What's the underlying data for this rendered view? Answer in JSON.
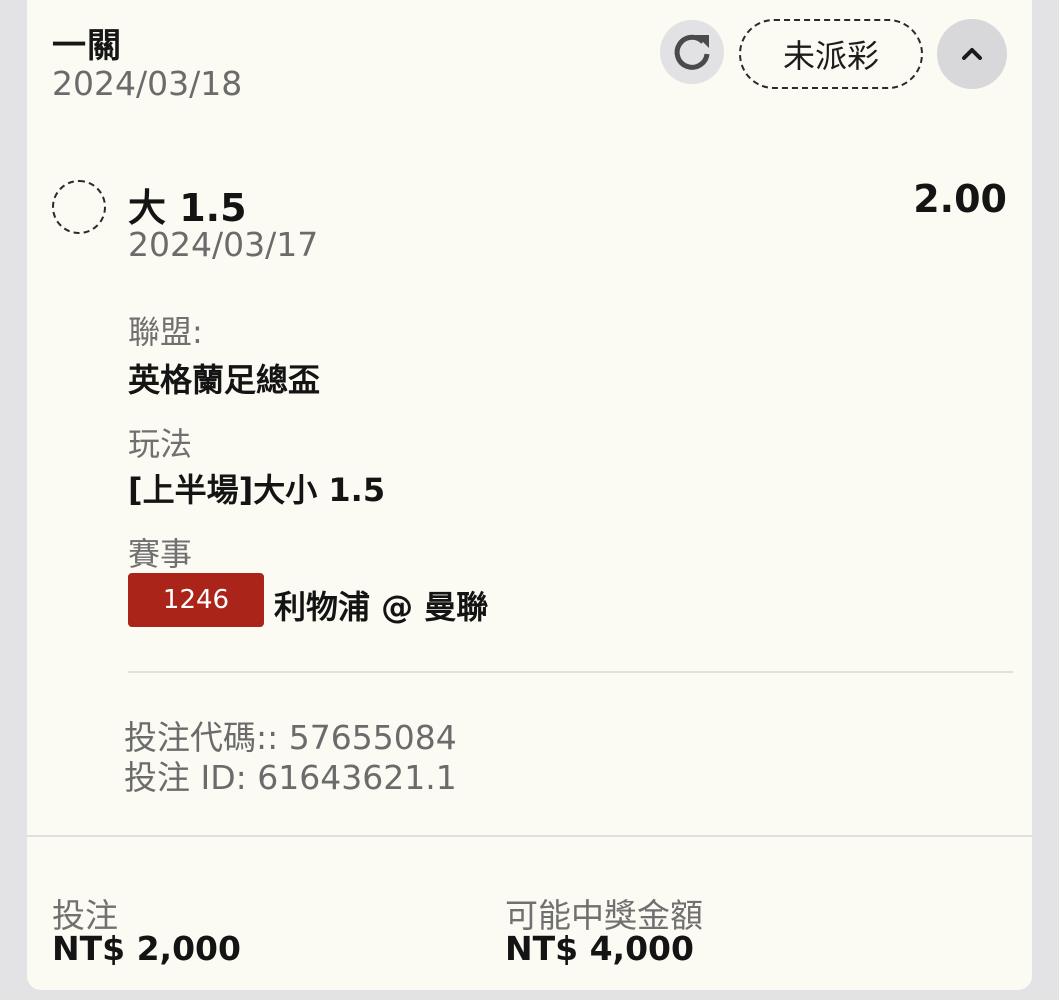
{
  "bet": {
    "type": "一關",
    "date": "2024/03/18",
    "status": "未派彩"
  },
  "selection": {
    "title": "大 1.5",
    "odds": "2.00",
    "date": "2024/03/17",
    "league_label": "聯盟:",
    "league_value": "英格蘭足總盃",
    "market_label": "玩法",
    "market_value": "[上半場]大小 1.5",
    "event_label": "賽事",
    "event_code": "1246",
    "event_name": "利物浦 @ 曼聯"
  },
  "refs": {
    "bet_code": "投注代碼:: 57655084",
    "bet_id": "投注 ID: 61643621.1"
  },
  "footer": {
    "stake_label": "投注",
    "stake_value": "NT$ 2,000",
    "payout_label": "可能中獎金額",
    "payout_value": "NT$ 4,000"
  },
  "icons": {
    "refresh": "refresh-icon",
    "collapse": "chevron-up-icon"
  },
  "colors": {
    "badge": "#ab2419",
    "card": "#fbfaf3"
  }
}
